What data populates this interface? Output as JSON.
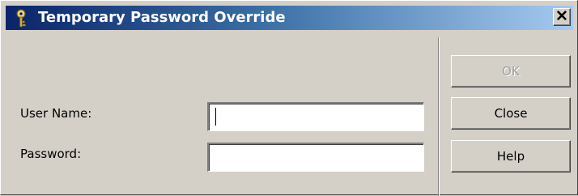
{
  "window": {
    "title": "Temporary Password Override",
    "title_icon": "key-icon",
    "close_glyph": "✕",
    "colors": {
      "title_start": "#0a246a",
      "title_end": "#a6caf0",
      "face": "#d4d0c8"
    }
  },
  "form": {
    "user_name_label": "User Name:",
    "user_name_value": "",
    "password_label": "Password:",
    "password_value": ""
  },
  "buttons": {
    "ok_label": "OK",
    "ok_enabled": false,
    "close_label": "Close",
    "help_label": "Help"
  }
}
